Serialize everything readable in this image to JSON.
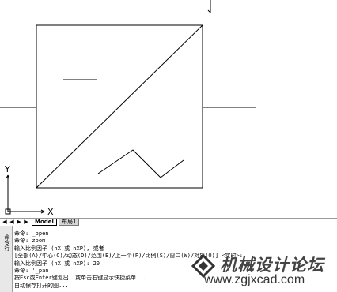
{
  "tabs": {
    "model": "Model",
    "layout1": "布局1"
  },
  "command_side": {
    "label": "命令行"
  },
  "command_history": [
    "命令: _open",
    "命令: zoom",
    "输入比例因子 (nX 或 nXP), 或者",
    "[全部(A)/中心(C)/动态(D)/范围(E)/上一个(P)/比例(S)/窗口(W)/对象(O)] <实时>:",
    "输入比例因子 (nX 或 nXP): 20",
    "命令: '_pan",
    "按Esc或Enter键退出, 或单击右键显示快捷菜单...",
    "自动保存打开的图..."
  ],
  "axes": {
    "x_label": "X",
    "y_label": "Y"
  },
  "watermark": {
    "title": "机械设计论坛",
    "url": "www.zgjxcad.com"
  },
  "colors": {
    "canvas_bg": "#ffffff",
    "line": "#000000"
  }
}
